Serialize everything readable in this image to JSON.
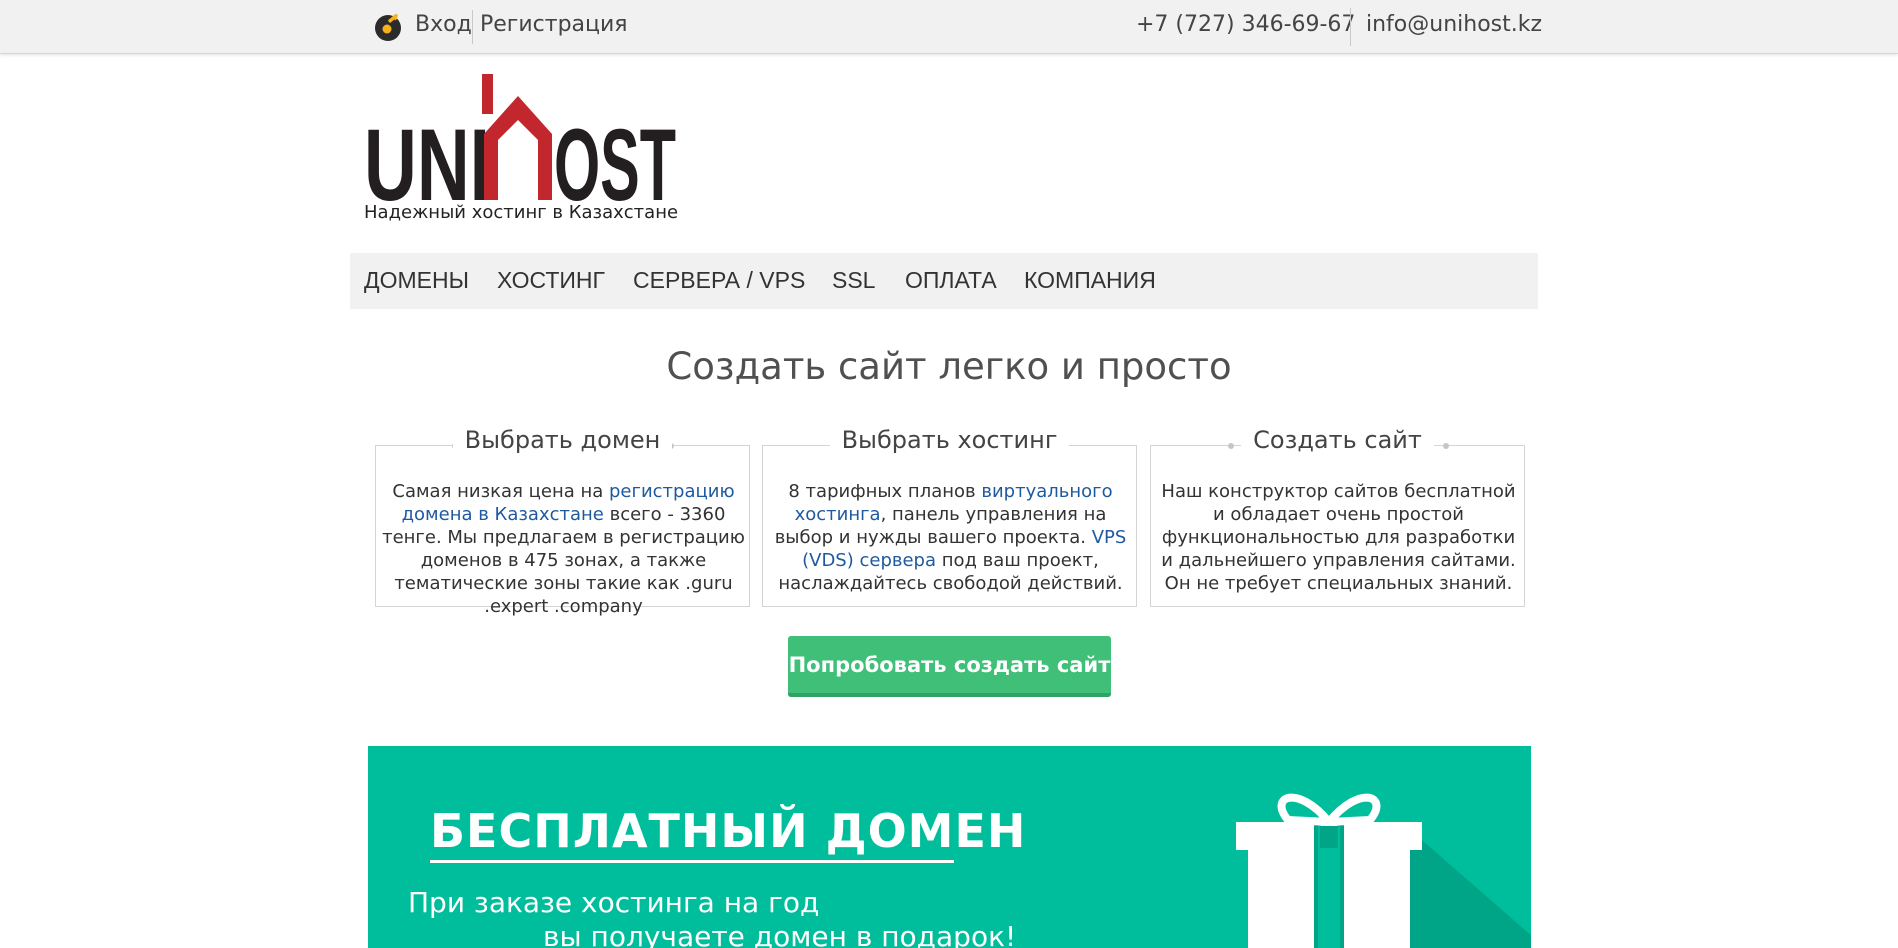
{
  "topbar": {
    "login_label": "Вход",
    "register_label": "Регистрация",
    "phone": "+7 (727) 346-69-67",
    "email": "info@unihost.kz"
  },
  "logo": {
    "brand_left": "UNI",
    "brand_right": "OST",
    "tagline": "Надежный хостинг в Казахстане",
    "colors": {
      "dark": "#231f20",
      "red": "#c1272d"
    }
  },
  "nav": {
    "items": [
      {
        "label": "ДОМЕНЫ"
      },
      {
        "label": "ХОСТИНГ"
      },
      {
        "label": "СЕРВЕРА / VPS"
      },
      {
        "label": "SSL"
      },
      {
        "label": "ОПЛАТА"
      },
      {
        "label": "КОМПАНИЯ"
      }
    ]
  },
  "main": {
    "headline": "Создать сайт легко и просто",
    "cards": [
      {
        "title": "Выбрать домен",
        "p1": "Самая низкая цена на ",
        "link1": "регистрацию домена в Казахстане",
        "p2": " всего - 3360 тенге. Мы предлагаем в регистрацию доменов в 475 зонах, а также тематические зоны такие как .guru .expert .company"
      },
      {
        "title": "Выбрать хостинг",
        "p1": "8 тарифных планов ",
        "link1": "виртуального хостинга",
        "p2": ", панель управления на выбор и нужды вашего проекта. ",
        "link2": "VPS (VDS) сервера",
        "p3": " под ваш проект, наслаждайтесь свободой действий."
      },
      {
        "title": "Создать сайт",
        "p1": "Наш конструктор сайтов бесплатной и обладает очень простой функциональностью для разработки и дальнейшего управления сайтами. Он не требует специальных знаний."
      }
    ],
    "cta_label": "Попробовать создать сайт"
  },
  "banner": {
    "title": "БЕСПЛАТНЫЙ ДОМЕН",
    "line1": "При заказе хостинга на год",
    "line2": "вы получаете домен в подарок!",
    "colors": {
      "background": "#00be9b",
      "accent_dark": "#00a587"
    }
  },
  "colors": {
    "link": "#1f5aa0",
    "cta": "#3fbf78",
    "topbar_bg": "#f1f1f1"
  }
}
